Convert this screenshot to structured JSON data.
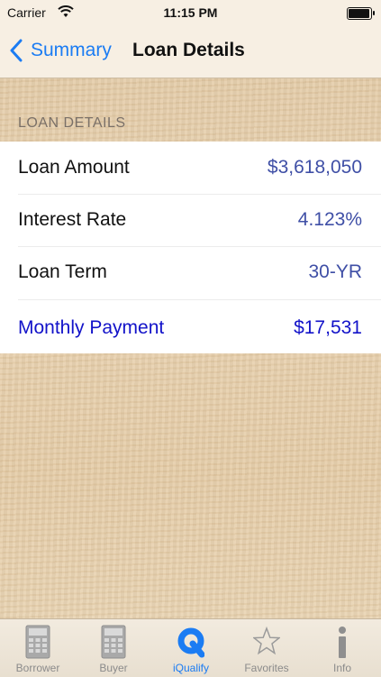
{
  "status_bar": {
    "carrier": "Carrier",
    "time": "11:15 PM",
    "battery_level": 0.95
  },
  "nav": {
    "back_label": "Summary",
    "title": "Loan Details"
  },
  "section": {
    "header": "LOAN DETAILS",
    "rows": [
      {
        "label": "Loan Amount",
        "value": "$3,618,050"
      },
      {
        "label": "Interest Rate",
        "value": "4.123%"
      },
      {
        "label": "Loan Term",
        "value": "30-YR"
      },
      {
        "label": "Monthly Payment",
        "value": "$17,531"
      }
    ]
  },
  "tabbar": {
    "active_color": "#1b7cf3",
    "tabs": [
      {
        "label": "Borrower",
        "icon": "calculator-icon"
      },
      {
        "label": "Buyer",
        "icon": "calculator-icon"
      },
      {
        "label": "iQualify",
        "icon": "q-logo-icon"
      },
      {
        "label": "Favorites",
        "icon": "star-icon"
      },
      {
        "label": "Info",
        "icon": "info-icon"
      }
    ],
    "active_index": 2
  }
}
